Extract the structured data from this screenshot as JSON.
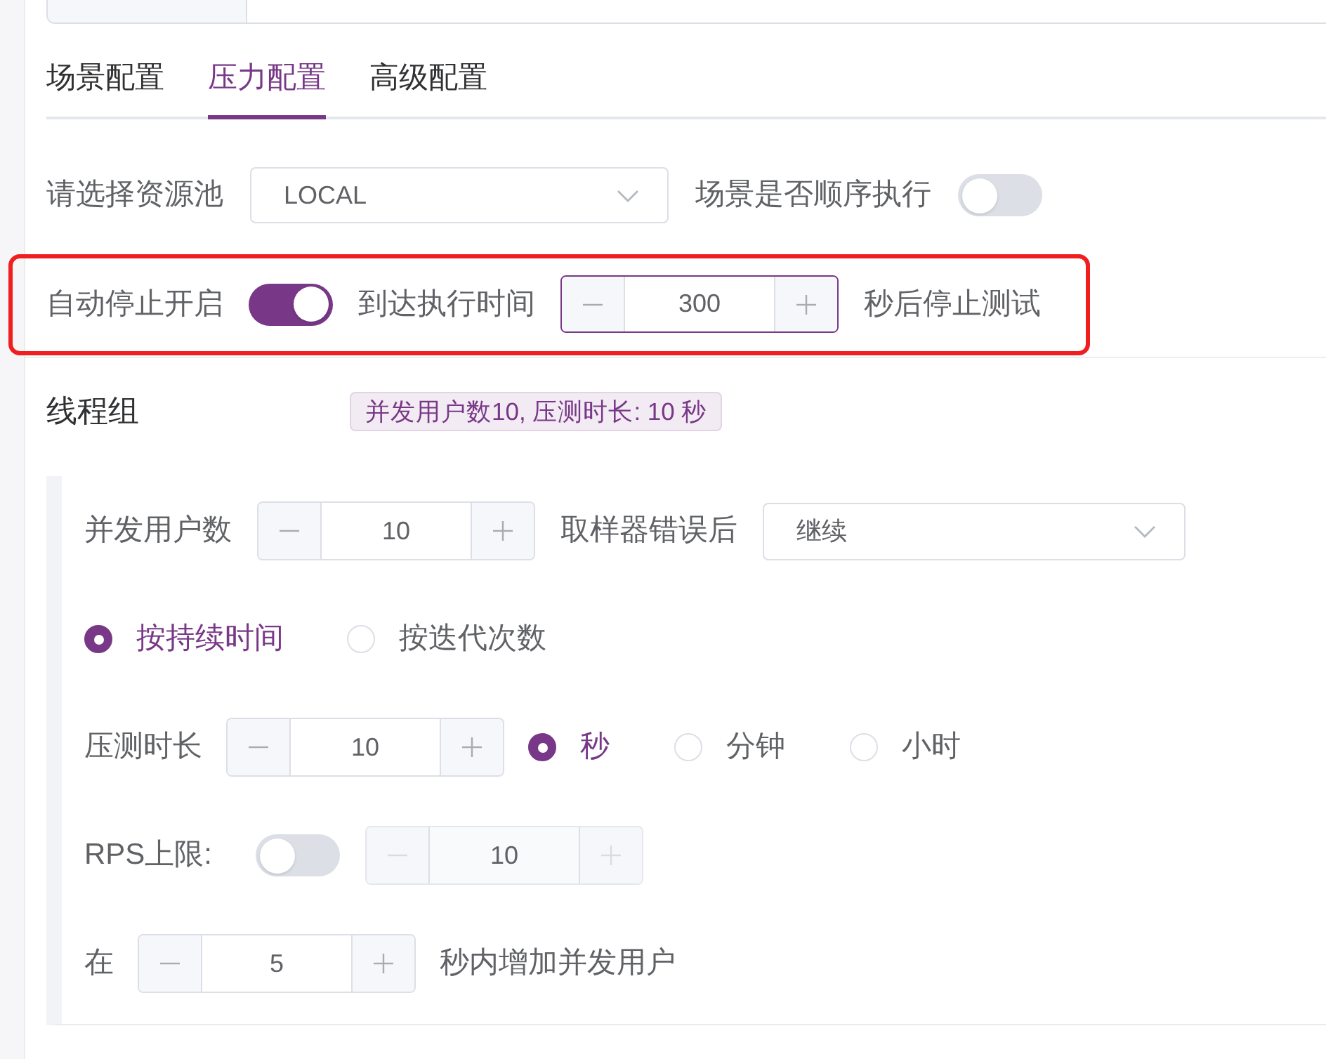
{
  "tabs": [
    {
      "label": "场景配置",
      "selected": false
    },
    {
      "label": "压力配置",
      "selected": true
    },
    {
      "label": "高级配置",
      "selected": false
    }
  ],
  "resource_pool": {
    "label": "请选择资源池",
    "value": "LOCAL"
  },
  "sequential_execution": {
    "label": "场景是否顺序执行",
    "on": false
  },
  "auto_stop": {
    "highlighted": true,
    "label": "自动停止开启",
    "on": true,
    "time_label": "到达执行时间",
    "value": "300",
    "focused": true,
    "suffix": "秒后停止测试"
  },
  "thread_group": {
    "title": "线程组",
    "summary": "并发用户数10, 压测时长: 10 秒",
    "concurrent_users": {
      "label": "并发用户数",
      "value": "10"
    },
    "on_sample_error": {
      "label": "取样器错误后",
      "value": "继续"
    },
    "modes": [
      {
        "label": "按持续时间",
        "selected": true
      },
      {
        "label": "按迭代次数",
        "selected": false
      }
    ],
    "duration": {
      "label": "压测时长",
      "value": "10",
      "units": [
        {
          "label": "秒",
          "selected": true
        },
        {
          "label": "分钟",
          "selected": false
        },
        {
          "label": "小时",
          "selected": false
        }
      ]
    },
    "rps_limit": {
      "label": "RPS上限:",
      "on": false,
      "value": "10",
      "disabled": true
    },
    "ramp_up": {
      "prefix": "在",
      "value": "5",
      "suffix": "秒内增加并发用户"
    }
  }
}
